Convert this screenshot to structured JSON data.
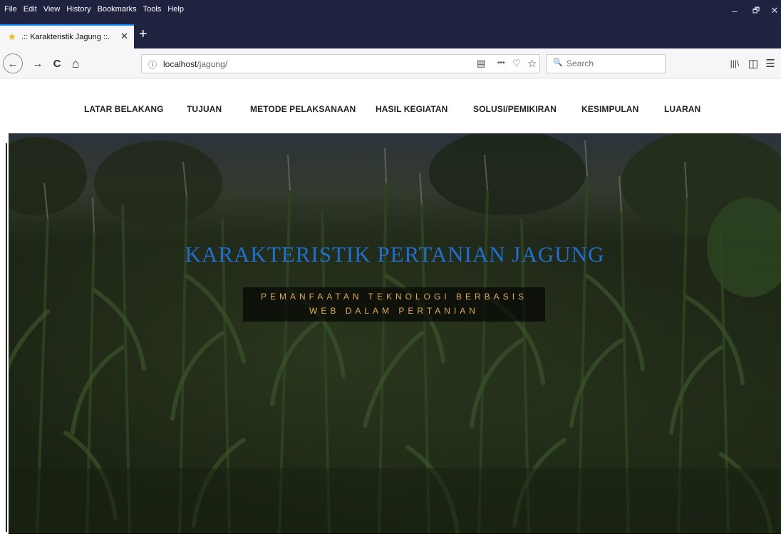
{
  "browser": {
    "menu": [
      {
        "key": "F",
        "rest": "ile"
      },
      {
        "key": "E",
        "rest": "dit"
      },
      {
        "key": "V",
        "rest": "iew"
      },
      {
        "pre": "Hi",
        "key": "s",
        "rest": "tory"
      },
      {
        "key": "B",
        "rest": "ookmarks"
      },
      {
        "key": "T",
        "rest": "ools"
      },
      {
        "key": "H",
        "rest": "elp"
      }
    ],
    "menu_text": [
      "File",
      "Edit",
      "View",
      "History",
      "Bookmarks",
      "Tools",
      "Help"
    ],
    "tab_title": ".:: Karakteristik Jagung ::.",
    "new_tab": "+",
    "url_host": "localhost",
    "url_path": "/jagung/",
    "search_placeholder": "Search",
    "icons": {
      "minimize": "–",
      "restore": "🗗",
      "close": "✕",
      "back": "←",
      "forward": "→",
      "reload": "C",
      "home": "⌂",
      "info": "ⓘ",
      "reader": "▤",
      "more": "•••",
      "pocket": "♡",
      "bookmark": "☆",
      "search": "🔍",
      "library": "|||\\",
      "sidebar": "◫",
      "menu": "☰",
      "tab_close": "✕",
      "favicon": "★"
    },
    "accent": "#0a84ff",
    "chrome_color": "#202340"
  },
  "site": {
    "nav": [
      "LATAR BELAKANG",
      "TUJUAN",
      "METODE PELAKSANAAN",
      "HASIL KEGIATAN",
      "SOLUSI/PEMIKIRAN",
      "KESIMPULAN",
      "LUARAN"
    ],
    "hero_title": "KARAKTERISTIK PERTANIAN JAGUNG",
    "hero_sub_line1": "PEMANFAATAN TEKNOLOGI BERBASIS",
    "hero_sub_line2": "WEB DALAM PERTANIAN",
    "title_color": "#1f6fd1",
    "subtitle_color": "#e2a848"
  }
}
